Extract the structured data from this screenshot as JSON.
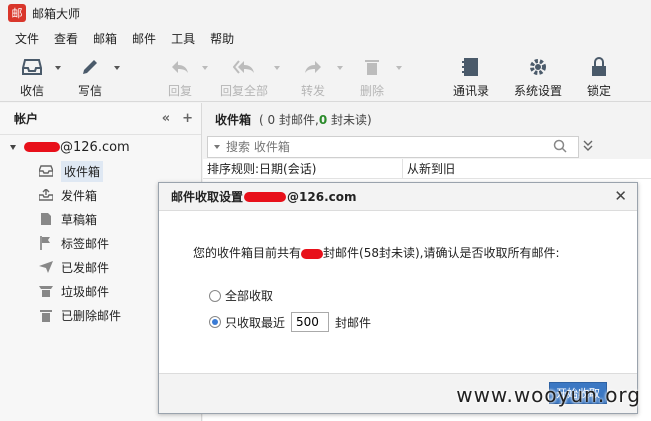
{
  "app": {
    "title": "邮箱大师",
    "logo_char": "邮"
  },
  "menu": [
    "文件",
    "查看",
    "邮箱",
    "邮件",
    "工具",
    "帮助"
  ],
  "toolbar": {
    "receive": "收信",
    "compose": "写信",
    "reply": "回复",
    "reply_all": "回复全部",
    "forward": "转发",
    "delete": "删除",
    "contacts": "通讯录",
    "settings": "系统设置",
    "lock": "锁定"
  },
  "sidebar": {
    "header": "帐户",
    "account_suffix": "@126.com",
    "folders": [
      {
        "label": "收件箱",
        "icon": "inbox-icon"
      },
      {
        "label": "发件箱",
        "icon": "outbox-icon"
      },
      {
        "label": "草稿箱",
        "icon": "draft-icon"
      },
      {
        "label": "标签邮件",
        "icon": "flag-icon"
      },
      {
        "label": "已发邮件",
        "icon": "send-icon"
      },
      {
        "label": "垃圾邮件",
        "icon": "trash-bin-icon"
      },
      {
        "label": "已删除邮件",
        "icon": "delete-icon"
      }
    ]
  },
  "main": {
    "title": "收件箱",
    "count_prefix": "(",
    "total": "0",
    "total_label": "封邮件,",
    "unread": "0",
    "unread_label": "封未读)",
    "search_placeholder": "搜索 收件箱",
    "sort_rule": "排序规则:日期(会话)",
    "sort_order": "从新到旧"
  },
  "dialog": {
    "title_prefix": "邮件收取设置",
    "title_suffix": "@126.com",
    "message_prefix": "您的收件箱目前共有",
    "message_suffix": "封邮件(58封未读),请确认是否收取所有邮件:",
    "option_all": "全部收取",
    "option_recent_prefix": "只收取最近",
    "recent_value": "500",
    "option_recent_suffix": "封邮件",
    "start_button": "开始收取"
  },
  "watermark": "www.wooyun.org",
  "colors": {
    "accent": "#3c78c3",
    "redaction": "#e8101a",
    "logo": "#d9362b"
  }
}
